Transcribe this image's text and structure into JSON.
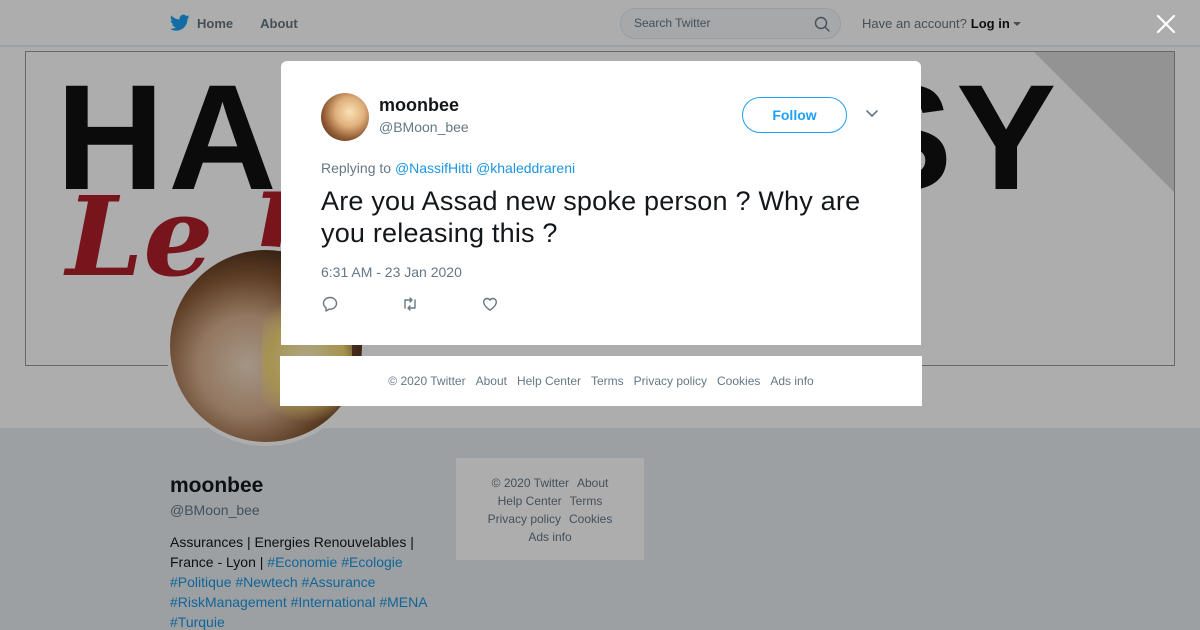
{
  "nav": {
    "home_label": "Home",
    "about_label": "About"
  },
  "search": {
    "placeholder": "Search Twitter"
  },
  "account": {
    "prompt": "Have an account?",
    "login_label": "Log in"
  },
  "banner": {
    "line1": "HAPPY EASY",
    "line2": "Le langage."
  },
  "profile": {
    "name": "moonbee",
    "handle": "@BMoon_bee",
    "bio_text": "Assurances | Energies Renouvelables | France - Lyon |",
    "bio_hashtags": "#Economie #Ecologie #Politique #Newtech #Assurance #RiskManagement #International #MENA #Turquie"
  },
  "side_footer": {
    "copyright": "© 2020 Twitter",
    "about": "About",
    "help": "Help Center",
    "terms": "Terms",
    "privacy": "Privacy policy",
    "cookies": "Cookies",
    "ads": "Ads info"
  },
  "tweet": {
    "author_name": "moonbee",
    "author_handle": "@BMoon_bee",
    "follow_label": "Follow",
    "replying_prefix": "Replying to",
    "mention1": "@NassifHitti",
    "mention2": "@khaleddrareni",
    "text": "Are you Assad new spoke person ? Why are you releasing this ?",
    "timestamp": "6:31 AM - 23 Jan 2020"
  },
  "modal_footer": {
    "copyright": "© 2020 Twitter",
    "about": "About",
    "help": "Help Center",
    "terms": "Terms",
    "privacy": "Privacy policy",
    "cookies": "Cookies",
    "ads": "Ads info"
  },
  "colors": {
    "twitter_blue": "#1da1f2",
    "link_blue": "#1b95e0",
    "text_gray": "#657786"
  },
  "icons": {
    "logo": "twitter-bird-icon",
    "search": "search-icon",
    "close": "close-icon",
    "menu": "chevron-down-icon",
    "reply": "reply-icon",
    "retweet": "retweet-icon",
    "like": "heart-icon"
  }
}
